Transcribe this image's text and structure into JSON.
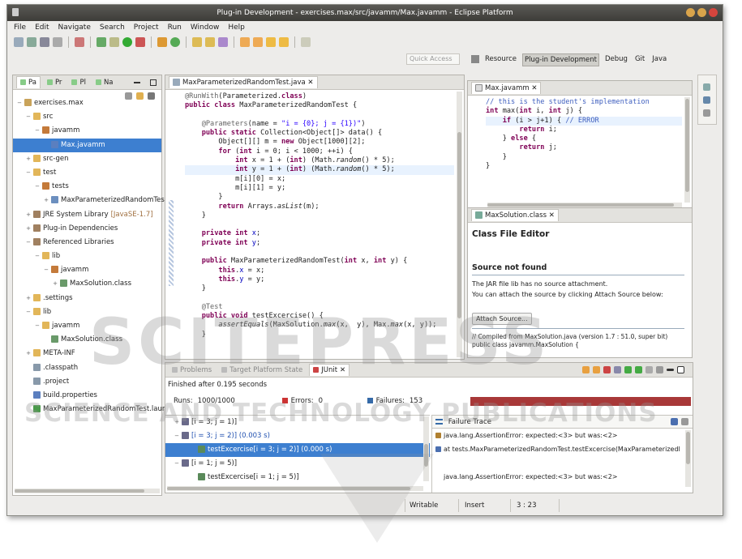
{
  "window": {
    "title": "Plug-in Development - exercises.max/src/javamm/Max.javamm - Eclipse Platform"
  },
  "menu": [
    "File",
    "Edit",
    "Navigate",
    "Search",
    "Project",
    "Run",
    "Window",
    "Help"
  ],
  "quick_access": {
    "placeholder": "Quick Access"
  },
  "perspectives": [
    {
      "label": "Resource",
      "active": false
    },
    {
      "label": "Plug-in Development",
      "active": true
    },
    {
      "label": "Debug",
      "active": false
    },
    {
      "label": "Git",
      "active": false
    },
    {
      "label": "Java",
      "active": false
    }
  ],
  "explorer": {
    "tabs": [
      "Pa",
      "Pr",
      "Pl",
      "Na"
    ],
    "tree": [
      {
        "label": "exercises.max",
        "indent": 0,
        "twisty": "−",
        "icon": "project-icon"
      },
      {
        "label": "src",
        "indent": 1,
        "twisty": "−",
        "icon": "folder-icon"
      },
      {
        "label": "javamm",
        "indent": 2,
        "twisty": "−",
        "icon": "package-icon"
      },
      {
        "label": "Max.javamm",
        "indent": 3,
        "twisty": "",
        "icon": "file-icon",
        "selected": true
      },
      {
        "label": "src-gen",
        "indent": 1,
        "twisty": "+",
        "icon": "folder-icon"
      },
      {
        "label": "test",
        "indent": 1,
        "twisty": "−",
        "icon": "folder-icon"
      },
      {
        "label": "tests",
        "indent": 2,
        "twisty": "−",
        "icon": "package-icon"
      },
      {
        "label": "MaxParameterizedRandomTest",
        "indent": 3,
        "twisty": "+",
        "icon": "java-file-icon"
      },
      {
        "label": "JRE System Library",
        "suffix": "[JavaSE-1.7]",
        "indent": 1,
        "twisty": "+",
        "icon": "library-icon"
      },
      {
        "label": "Plug-in Dependencies",
        "indent": 1,
        "twisty": "+",
        "icon": "library-icon"
      },
      {
        "label": "Referenced Libraries",
        "indent": 1,
        "twisty": "−",
        "icon": "library-icon"
      },
      {
        "label": "lib",
        "indent": 2,
        "twisty": "−",
        "icon": "folder-icon"
      },
      {
        "label": "javamm",
        "indent": 3,
        "twisty": "−",
        "icon": "package-icon"
      },
      {
        "label": "MaxSolution.class",
        "indent": 4,
        "twisty": "+",
        "icon": "class-icon"
      },
      {
        "label": ".settings",
        "indent": 1,
        "twisty": "+",
        "icon": "folder-icon"
      },
      {
        "label": "lib",
        "indent": 1,
        "twisty": "−",
        "icon": "folder-icon"
      },
      {
        "label": "javamm",
        "indent": 2,
        "twisty": "−",
        "icon": "folder-icon"
      },
      {
        "label": "MaxSolution.class",
        "indent": 3,
        "twisty": "",
        "icon": "class-icon"
      },
      {
        "label": "META-INF",
        "indent": 1,
        "twisty": "+",
        "icon": "folder-icon"
      },
      {
        "label": ".classpath",
        "indent": 1,
        "twisty": "",
        "icon": "xml-file-icon"
      },
      {
        "label": ".project",
        "indent": 1,
        "twisty": "",
        "icon": "xml-file-icon"
      },
      {
        "label": "build.properties",
        "indent": 1,
        "twisty": "",
        "icon": "file-icon"
      },
      {
        "label": "MaxParameterizedRandomTest.laun",
        "indent": 1,
        "twisty": "",
        "icon": "launch-icon"
      }
    ]
  },
  "editor": {
    "tab": "MaxParameterizedRandomTest.java",
    "lines": [
      [
        [
          "ann",
          "@RunWith"
        ],
        [
          "",
          "(Parameterized."
        ],
        [
          "kw",
          "class"
        ],
        [
          "",
          ")"
        ]
      ],
      [
        [
          "kw",
          "public class "
        ],
        [
          "",
          "MaxParameterizedRandomTest {"
        ]
      ],
      [
        [
          "",
          ""
        ]
      ],
      [
        [
          "ann",
          "    @Parameters"
        ],
        [
          "",
          "(name = "
        ],
        [
          "str",
          "\"i = {0}; j = {1})\""
        ],
        [
          "",
          ")"
        ]
      ],
      [
        [
          "kw",
          "    public static "
        ],
        [
          "",
          "Collection<Object[]> data() {"
        ]
      ],
      [
        [
          "",
          "        Object[][] m = "
        ],
        [
          "kw",
          "new "
        ],
        [
          "",
          "Object[1000][2];"
        ]
      ],
      [
        [
          "kw",
          "        for "
        ],
        [
          "",
          "("
        ],
        [
          "kw",
          "int "
        ],
        [
          "",
          "i = 0; i < 1000; ++i) {"
        ]
      ],
      [
        [
          "kw",
          "            int "
        ],
        [
          "",
          "x = 1 + ("
        ],
        [
          "kw",
          "int"
        ],
        [
          "",
          ") (Math."
        ],
        [
          "it",
          "random"
        ],
        [
          "",
          "() * 5);"
        ]
      ],
      [
        [
          "kw",
          "            int "
        ],
        [
          "",
          "y = 1 + ("
        ],
        [
          "kw",
          "int"
        ],
        [
          "",
          ") (Math."
        ],
        [
          "it",
          "random"
        ],
        [
          "",
          "() * 5);"
        ]
      ],
      [
        [
          "",
          "            m[i][0] = x;"
        ]
      ],
      [
        [
          "",
          "            m[i][1] = y;"
        ]
      ],
      [
        [
          "",
          "        }"
        ]
      ],
      [
        [
          "kw",
          "        return "
        ],
        [
          "",
          "Arrays."
        ],
        [
          "it",
          "asList"
        ],
        [
          "",
          "(m);"
        ]
      ],
      [
        [
          "",
          "    }"
        ]
      ],
      [
        [
          "",
          ""
        ]
      ],
      [
        [
          "kw",
          "    private int "
        ],
        [
          "fl",
          "x"
        ],
        [
          "",
          ";"
        ]
      ],
      [
        [
          "kw",
          "    private int "
        ],
        [
          "fl",
          "y"
        ],
        [
          "",
          ";"
        ]
      ],
      [
        [
          "",
          ""
        ]
      ],
      [
        [
          "kw",
          "    public "
        ],
        [
          "",
          "MaxParameterizedRandomTest("
        ],
        [
          "kw",
          "int "
        ],
        [
          "",
          "x, "
        ],
        [
          "kw",
          "int "
        ],
        [
          "",
          "y) {"
        ]
      ],
      [
        [
          "kw",
          "        this"
        ],
        [
          "",
          "."
        ],
        [
          "fl",
          "x"
        ],
        [
          "",
          " = x;"
        ]
      ],
      [
        [
          "kw",
          "        this"
        ],
        [
          "",
          "."
        ],
        [
          "fl",
          "y"
        ],
        [
          "",
          " = y;"
        ]
      ],
      [
        [
          "",
          "    }"
        ]
      ],
      [
        [
          "",
          ""
        ]
      ],
      [
        [
          "ann",
          "    @Test"
        ]
      ],
      [
        [
          "kw",
          "    public void "
        ],
        [
          "",
          "testExcercise() {"
        ]
      ],
      [
        [
          "it",
          "        assertEquals"
        ],
        [
          "",
          "(MaxSolution."
        ],
        [
          "it",
          "max"
        ],
        [
          "",
          "(x,  y), Max."
        ],
        [
          "it",
          "max"
        ],
        [
          "",
          "(x, y));"
        ]
      ],
      [
        [
          "",
          "    }"
        ]
      ]
    ]
  },
  "max_editor": {
    "tab": "Max.javamm",
    "lines": [
      [
        [
          "cm",
          "// this is the student's implementation"
        ]
      ],
      [
        [
          "kw",
          "int "
        ],
        [
          "",
          "max("
        ],
        [
          "kw",
          "int "
        ],
        [
          "",
          "i, "
        ],
        [
          "kw",
          "int "
        ],
        [
          "",
          "j) {"
        ]
      ],
      [
        [
          "kw",
          "    if "
        ],
        [
          "",
          "(i > j+1) { "
        ],
        [
          "cm",
          "// ERROR"
        ]
      ],
      [
        [
          "kw",
          "        return "
        ],
        [
          "",
          "i;"
        ]
      ],
      [
        [
          "",
          "    } "
        ],
        [
          "kw",
          "else "
        ],
        [
          "",
          "{"
        ]
      ],
      [
        [
          "kw",
          "        return "
        ],
        [
          "",
          "j;"
        ]
      ],
      [
        [
          "",
          "    }"
        ]
      ],
      [
        [
          "",
          "}"
        ]
      ]
    ]
  },
  "class_editor": {
    "tab": "MaxSolution.class",
    "title": "Class File Editor",
    "section": "Source not found",
    "text1": "The JAR file lib has no source attachment.",
    "text2": "You can attach the source by clicking Attach Source below:",
    "button": "Attach Source...",
    "compiled1": "// Compiled from MaxSolution.java (version 1.7 : 51.0, super bit)",
    "compiled2": "public class javamm.MaxSolution {"
  },
  "junit": {
    "tabs": [
      "Problems",
      "Target Platform State",
      "JUnit"
    ],
    "finished": "Finished after 0.195 seconds",
    "runs_label": "Runs:",
    "runs": "1000/1000",
    "errors_label": "Errors:",
    "errors": "0",
    "failures_label": "Failures:",
    "failures": "153",
    "progress_color": "#a83838",
    "tests": [
      {
        "label": "[i = 3; j = 1)]",
        "indent": 0,
        "twisty": "+"
      },
      {
        "label": "[i = 3; j = 2)] (0.003 s)",
        "indent": 0,
        "twisty": "−",
        "blue": true
      },
      {
        "label": "testExcercise[i = 3; j = 2)] (0.000 s)",
        "indent": 1,
        "twisty": "",
        "selected": true
      },
      {
        "label": "[i = 1; j = 5)]",
        "indent": 0,
        "twisty": "−"
      },
      {
        "label": "testExcercise[i = 1; j = 5)]",
        "indent": 1,
        "twisty": ""
      }
    ],
    "trace_title": "Failure Trace",
    "trace": [
      "java.lang.AssertionError: expected:<3> but was:<2>",
      "at tests.MaxParameterizedRandomTest.testExcercise(MaxParameterizedRa",
      "",
      "java.lang.AssertionError: expected:<3> but was:<2>"
    ]
  },
  "status": {
    "writable": "Writable",
    "insert": "Insert",
    "position": "3 : 23"
  },
  "watermark": {
    "logo": "SCITEPRESS",
    "tagline": "SCIENCE AND TECHNOLOGY PUBLICATIONS"
  }
}
